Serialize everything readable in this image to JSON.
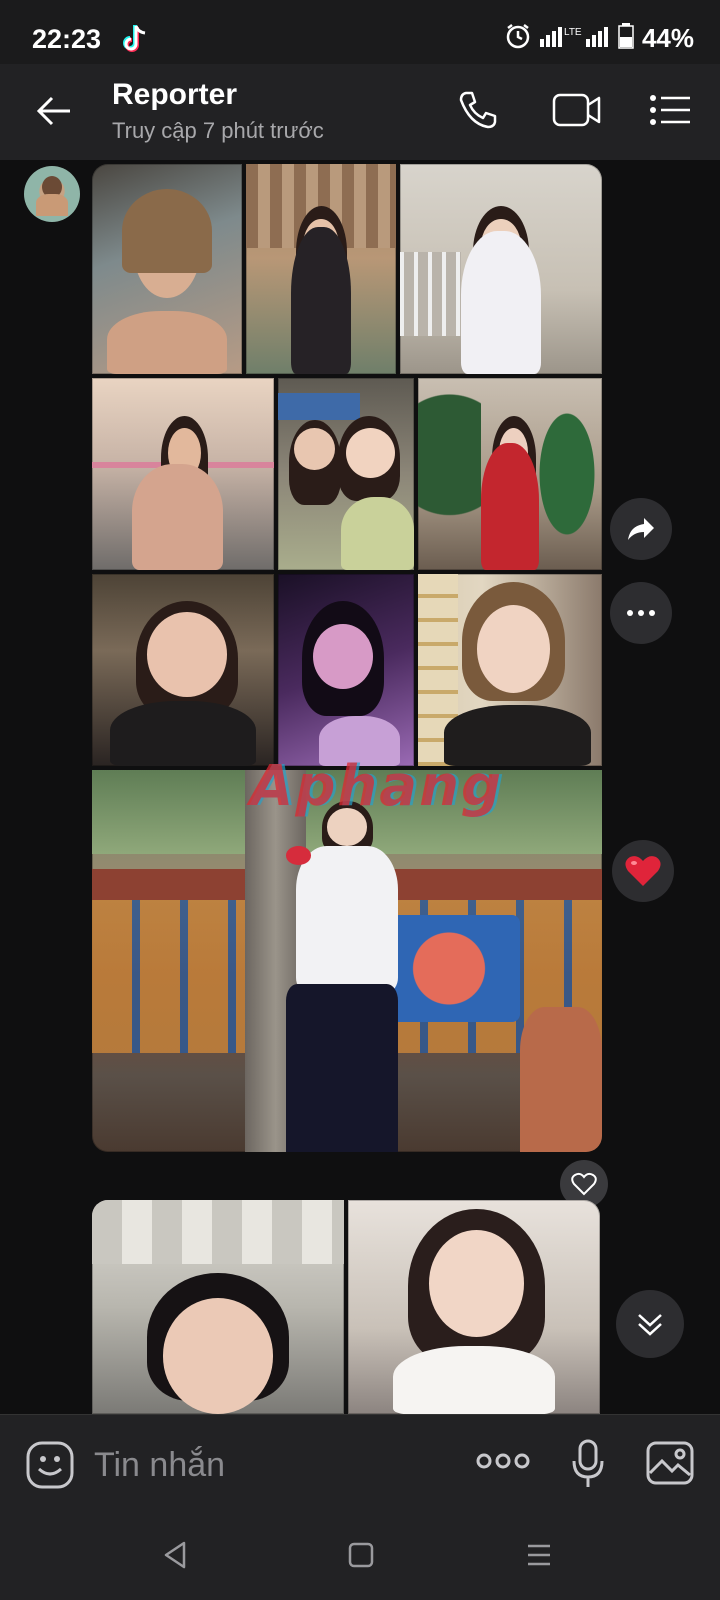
{
  "status_bar": {
    "time": "22:23",
    "network": "LTE",
    "battery": "44%",
    "icons": [
      "tiktok-icon",
      "alarm-icon",
      "signal-icon",
      "battery-icon"
    ]
  },
  "header": {
    "title": "Reporter",
    "subtitle": "Truy cập 7 phút trước",
    "icons": [
      "back-arrow-icon",
      "phone-call-icon",
      "video-call-icon",
      "menu-list-icon"
    ]
  },
  "messages": {
    "watermark": "Aphang",
    "reaction": "❤️",
    "icons": [
      "share-forward-icon",
      "more-options-icon",
      "heart-reaction-icon",
      "like-heart-icon",
      "scroll-down-icon"
    ]
  },
  "composer": {
    "placeholder": "Tin nhắn",
    "icons": [
      "sticker-emoji-icon",
      "more-dots-icon",
      "microphone-icon",
      "gallery-image-icon"
    ]
  },
  "navigation": {
    "icons": [
      "nav-back-icon",
      "nav-home-icon",
      "nav-recents-icon"
    ]
  },
  "colors": {
    "background": "#0f0f10",
    "header": "#222224",
    "bubble_button": "#2d2d30",
    "text_secondary": "#a8a8ab",
    "heart": "#e0243a"
  }
}
